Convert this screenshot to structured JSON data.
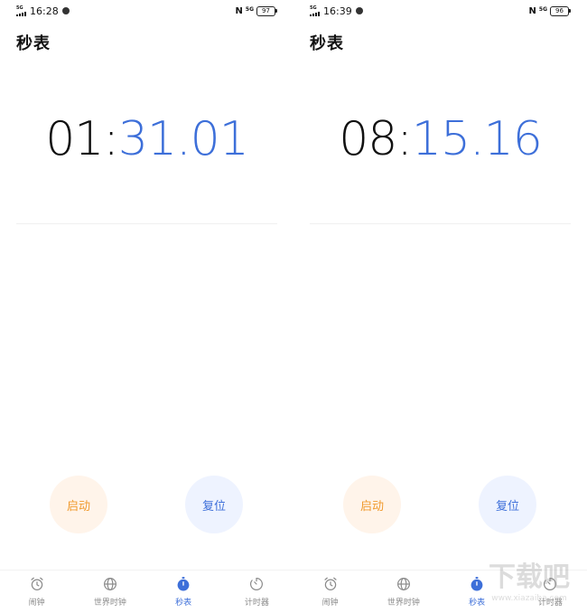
{
  "screens": [
    {
      "status": {
        "network": "5G",
        "time": "16:28",
        "battery": "97",
        "nfc": "N",
        "fiveg": "5G"
      },
      "title": "秒表",
      "readout": {
        "minutes": "01:",
        "seconds": "31.01"
      },
      "buttons": {
        "start": "启动",
        "reset": "复位"
      },
      "nav": [
        {
          "label": "闹钟",
          "icon": "alarm-clock-icon"
        },
        {
          "label": "世界时钟",
          "icon": "globe-icon"
        },
        {
          "label": "秒表",
          "icon": "stopwatch-icon"
        },
        {
          "label": "计时器",
          "icon": "timer-icon"
        }
      ]
    },
    {
      "status": {
        "network": "5G",
        "time": "16:39",
        "battery": "96",
        "nfc": "N",
        "fiveg": "5G"
      },
      "title": "秒表",
      "readout": {
        "minutes": "08:",
        "seconds": "15.16"
      },
      "buttons": {
        "start": "启动",
        "reset": "复位"
      },
      "nav": [
        {
          "label": "闹钟",
          "icon": "alarm-clock-icon"
        },
        {
          "label": "世界时钟",
          "icon": "globe-icon"
        },
        {
          "label": "秒表",
          "icon": "stopwatch-icon"
        },
        {
          "label": "计时器",
          "icon": "timer-icon"
        }
      ]
    }
  ],
  "colors": {
    "accent": "#3d6fd9",
    "start_text": "#f09a2e",
    "start_bg": "#fff4ea",
    "reset_bg": "#eef3ff",
    "inactive": "#8a8a8a"
  },
  "active_tab": "秒表",
  "watermark": "下载吧 www.xiazaiba.com"
}
